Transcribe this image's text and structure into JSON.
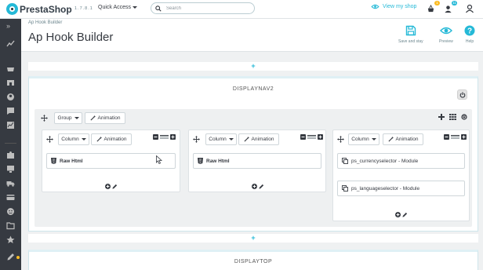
{
  "header": {
    "logo": "PrestaShop",
    "version": "1.7.8.1",
    "quick_access": "Quick Access",
    "search_placeholder": "Search",
    "view_shop": "View my shop",
    "orders_badge": "1",
    "customers_badge": "11"
  },
  "page": {
    "breadcrumb": "Ap Hook Builder",
    "title": "Ap Hook Builder",
    "save_and_stay": "Save and stay",
    "preview": "Preview",
    "help": "Help"
  },
  "builder": {
    "add_symbol": "+",
    "hook1": {
      "title": "DISPLAYNAV2",
      "group_label": "Group",
      "animation_label": "Animation",
      "columns": [
        {
          "label": "Column",
          "animation": "Animation",
          "widgets": [
            "Raw Html"
          ]
        },
        {
          "label": "Column",
          "animation": "Animation",
          "widgets": [
            "Raw Html"
          ]
        },
        {
          "label": "Column",
          "animation": "Animation",
          "widgets": [
            "ps_currencyselector - Module",
            "ps_languageselector - Module"
          ]
        }
      ]
    },
    "hook2": {
      "title": "DISPLAYTOP"
    }
  },
  "colors": {
    "accent": "#25b9d7",
    "sidebar": "#363a41",
    "notification": "#fbbb22"
  }
}
